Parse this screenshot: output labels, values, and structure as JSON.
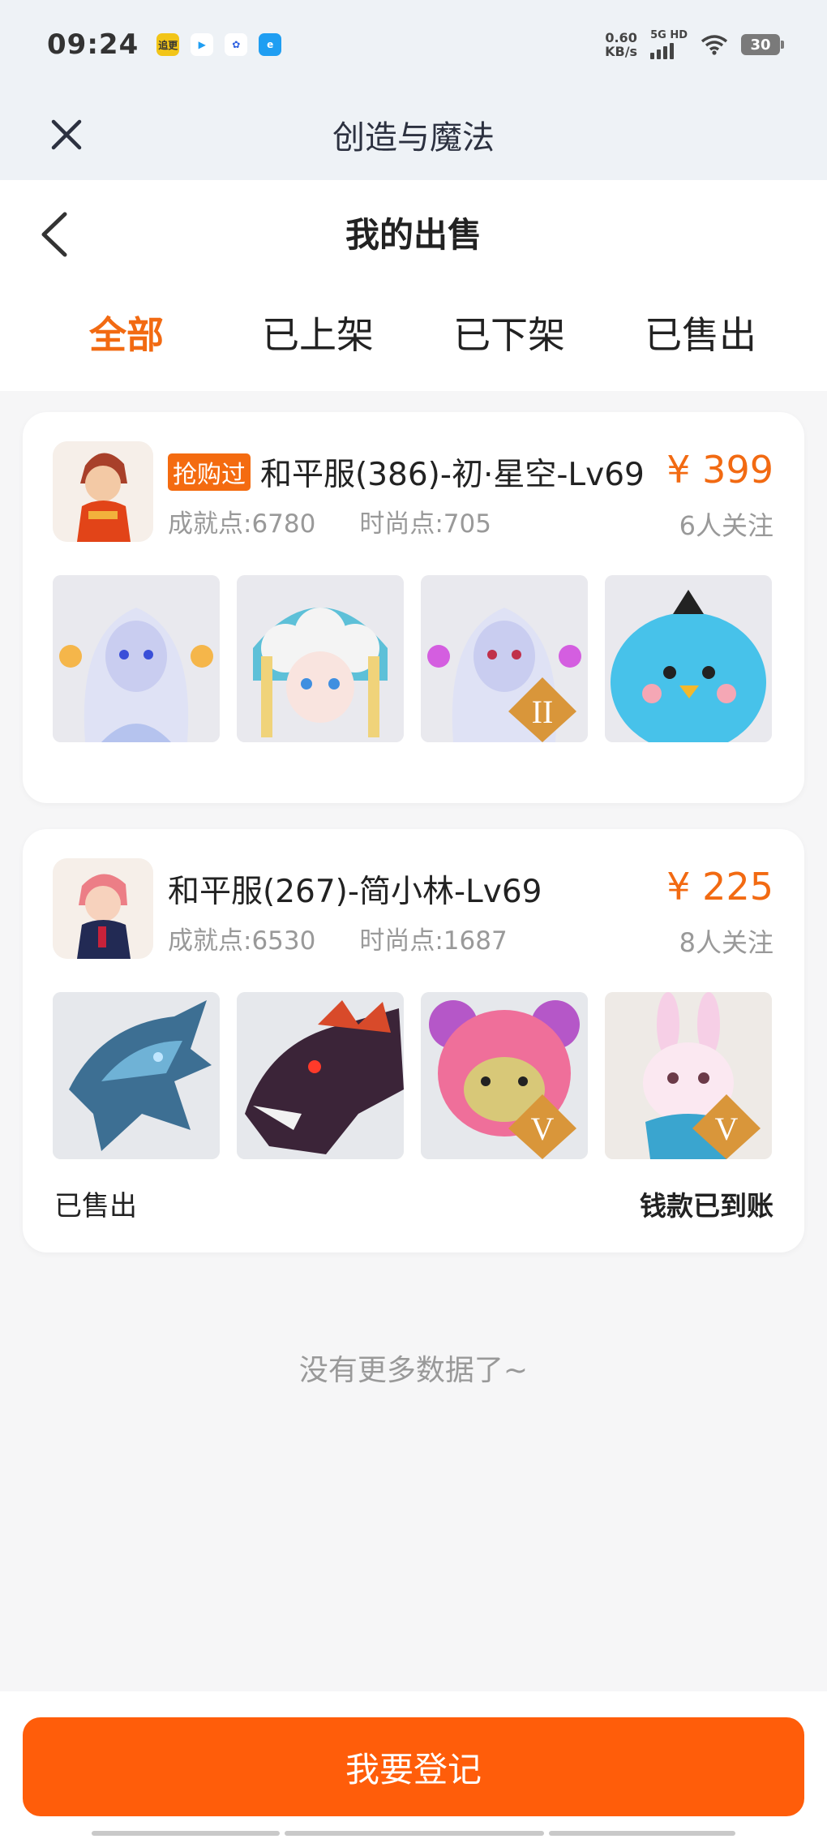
{
  "status_bar": {
    "time": "09:24",
    "net_speed_value": "0.60",
    "net_speed_unit": "KB/s",
    "net_type": "5G HD",
    "battery": "30",
    "apps": [
      {
        "icon": "yellow-app-icon",
        "label": "追更",
        "color": "#f2c518"
      },
      {
        "icon": "play-app-icon",
        "label": "▶",
        "color": "#ffffff"
      },
      {
        "icon": "baidu-paw-icon",
        "label": "✿",
        "color": "#ffffff"
      },
      {
        "icon": "browser-app-icon",
        "label": "e",
        "color": "#1f9ef2"
      }
    ]
  },
  "app_header": {
    "title": "创造与魔法"
  },
  "page": {
    "title": "我的出售"
  },
  "tabs": [
    {
      "label": "全部",
      "active": true
    },
    {
      "label": "已上架",
      "active": false
    },
    {
      "label": "已下架",
      "active": false
    },
    {
      "label": "已售出",
      "active": false
    }
  ],
  "listings": [
    {
      "badge": "抢购过",
      "title": "和平服(386)-初·星空-Lv69",
      "achievement": "成就点:6780",
      "fashion": "时尚点:705",
      "price": "¥ 399",
      "followers": "6人关注",
      "status": "",
      "payment": ""
    },
    {
      "badge": "",
      "title": "和平服(267)-简小林-Lv69",
      "achievement": "成就点:6530",
      "fashion": "时尚点:1687",
      "price": "¥ 225",
      "followers": "8人关注",
      "status": "已售出",
      "payment": "钱款已到账"
    }
  ],
  "no_more": "没有更多数据了~",
  "register_button": "我要登记",
  "colors": {
    "accent": "#f26a12",
    "button": "#ff5d0a"
  }
}
